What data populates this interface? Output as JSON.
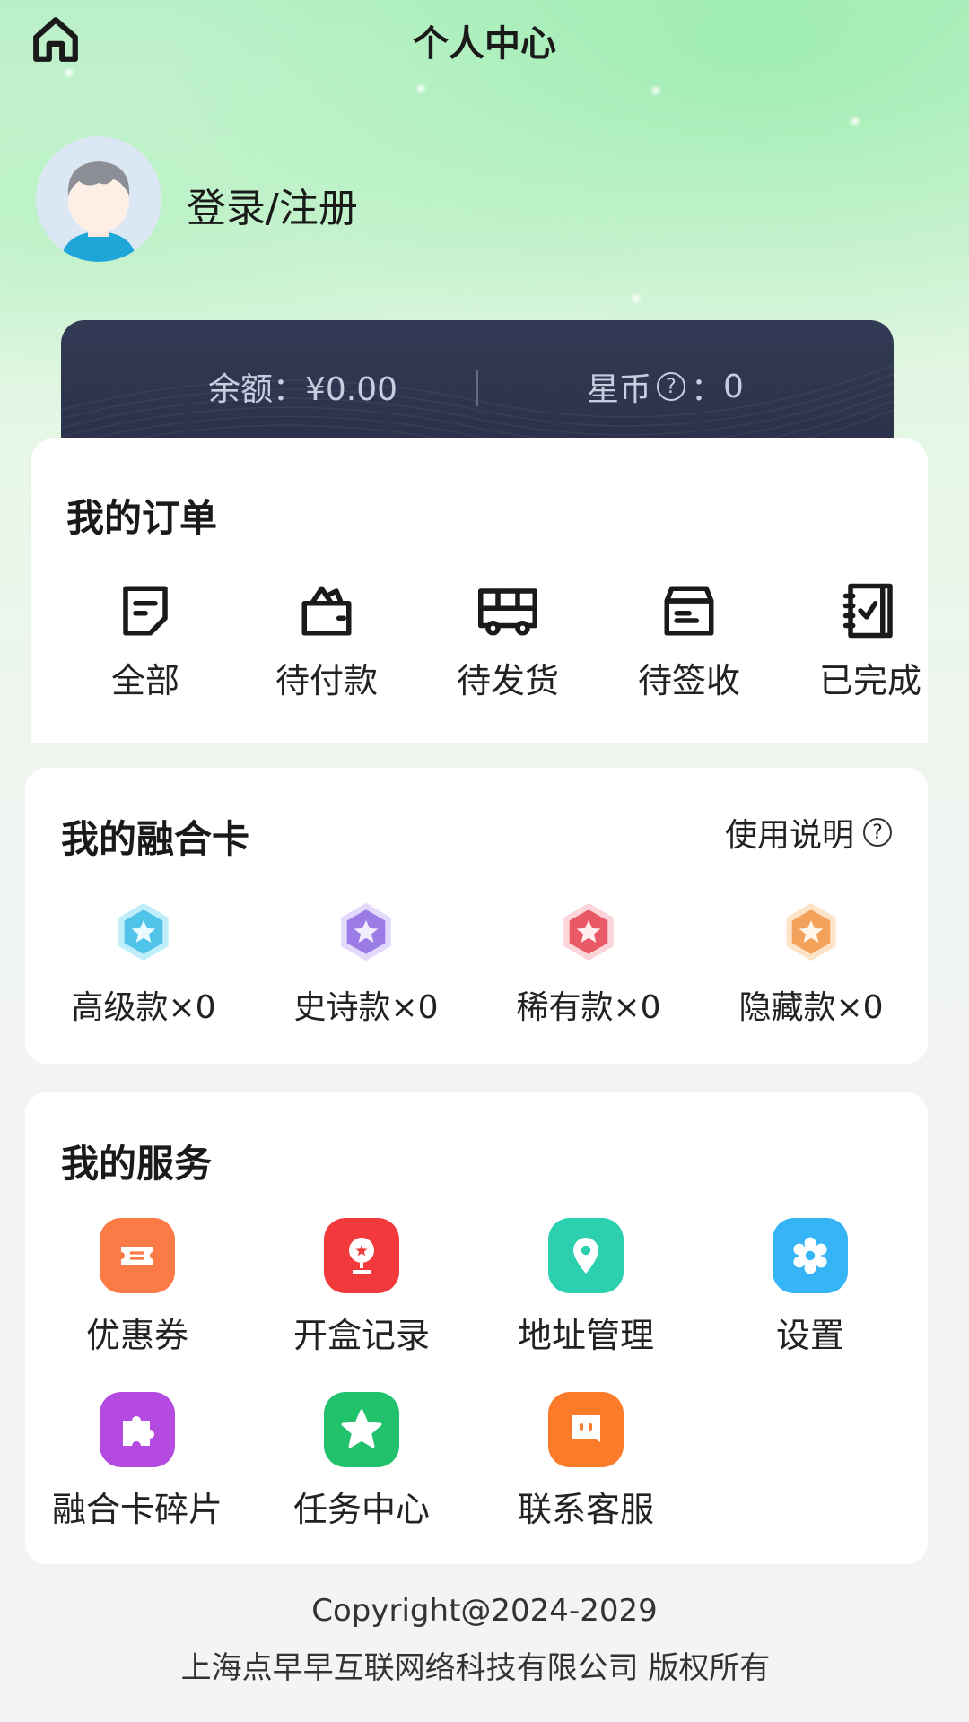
{
  "header": {
    "title": "个人中心"
  },
  "profile": {
    "login_label": "登录/注册"
  },
  "balance": {
    "balance_text": "余额：¥0.00",
    "stars_label": "星币",
    "stars_sep": "：",
    "stars_value": "0"
  },
  "orders": {
    "title": "我的订单",
    "items": [
      {
        "label": "全部",
        "icon": "document-icon"
      },
      {
        "label": "待付款",
        "icon": "wallet-icon"
      },
      {
        "label": "待发货",
        "icon": "bus-icon"
      },
      {
        "label": "待签收",
        "icon": "box-icon"
      },
      {
        "label": "已完成",
        "icon": "checklist-icon"
      }
    ]
  },
  "fusion": {
    "title": "我的融合卡",
    "usage_label": "使用说明",
    "items": [
      {
        "label": "高级款×0",
        "color": "#4fc3e8",
        "icon": "star-badge-blue-icon"
      },
      {
        "label": "史诗款×0",
        "color": "#9b7be6",
        "icon": "star-badge-purple-icon"
      },
      {
        "label": "稀有款×0",
        "color": "#ea5a66",
        "icon": "star-badge-red-icon"
      },
      {
        "label": "隐藏款×0",
        "color": "#f2a25a",
        "icon": "star-badge-orange-icon"
      }
    ]
  },
  "services": {
    "title": "我的服务",
    "items": [
      {
        "label": "优惠券",
        "color": "#fb7a45",
        "icon": "coupon-icon"
      },
      {
        "label": "开盒记录",
        "color": "#f23a3c",
        "icon": "trophy-icon"
      },
      {
        "label": "地址管理",
        "color": "#2ccfae",
        "icon": "location-icon"
      },
      {
        "label": "设置",
        "color": "#35b5f5",
        "icon": "gear-icon"
      },
      {
        "label": "融合卡碎片",
        "color": "#b44ae0",
        "icon": "puzzle-icon"
      },
      {
        "label": "任务中心",
        "color": "#22c26c",
        "icon": "star-icon"
      },
      {
        "label": "联系客服",
        "color": "#fb7b2a",
        "icon": "chat-icon"
      }
    ]
  },
  "footer": {
    "copyright": "Copyright@2024-2029",
    "company": "上海点早早互联网络科技有限公司 版权所有"
  }
}
